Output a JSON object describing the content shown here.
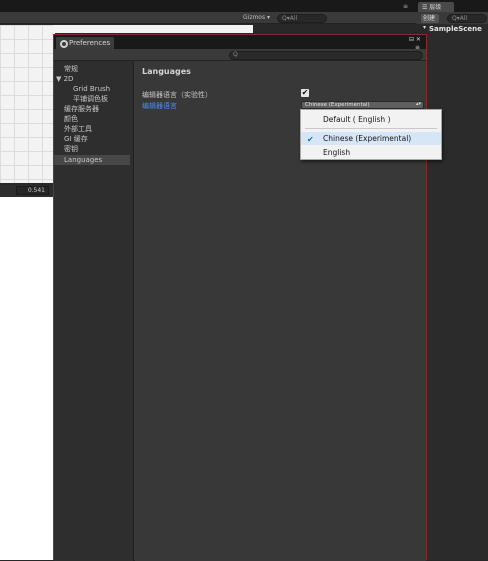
{
  "scene_toolbar": {
    "gizmos_label": "Gizmos ▾",
    "search_placeholder": "Q▾All",
    "menu_icon": "≡"
  },
  "hierarchy": {
    "tab_label": "☰ 层级",
    "create_label": "创建 ▾",
    "search_placeholder": "Q▾All",
    "scene_name": "SampleScene"
  },
  "scene_bottom_value": "0.541",
  "preferences": {
    "tab_label": "Preferences",
    "window_icons": "⊟ ✕",
    "menu_icon": "≡",
    "search_icon": "Q",
    "nav": [
      {
        "label": "常规",
        "indent": 1
      },
      {
        "label": "▼ 2D",
        "indent": 0
      },
      {
        "label": "Grid Brush",
        "indent": 2
      },
      {
        "label": "平铺调色板",
        "indent": 2
      },
      {
        "label": "缓存服务器",
        "indent": 1
      },
      {
        "label": "颜色",
        "indent": 1
      },
      {
        "label": "外部工具",
        "indent": 1
      },
      {
        "label": "GI 缓存",
        "indent": 1
      },
      {
        "label": "密钥",
        "indent": 1
      },
      {
        "label": "Languages",
        "indent": 1,
        "selected": true
      }
    ],
    "content": {
      "title": "Languages",
      "row1_label": "编辑器语言（实验性）",
      "row1_checked": "✔",
      "row2_label": "编辑器语言",
      "select_value": "Chinese (Experimental)",
      "select_arrow": "▴▾"
    }
  },
  "language_dropdown": {
    "items": [
      "Default ( English )",
      "Chinese (Experimental)",
      "English"
    ],
    "selected_index": 1,
    "check_icon": "✔"
  },
  "colors": {
    "accent_link": "#4f8cf0",
    "window_border": "#8a2b2b",
    "highlight": "#d7e6f7"
  }
}
